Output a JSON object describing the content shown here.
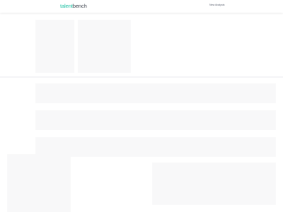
{
  "header": {
    "logo": {
      "part1": "talent",
      "part2": "bench"
    },
    "nav": {
      "new_analysis_label": "New Analysis"
    }
  },
  "colors": {
    "brand_green": "#22c1a4",
    "brand_dark": "#3f4650",
    "nav_text": "#5b6170"
  }
}
